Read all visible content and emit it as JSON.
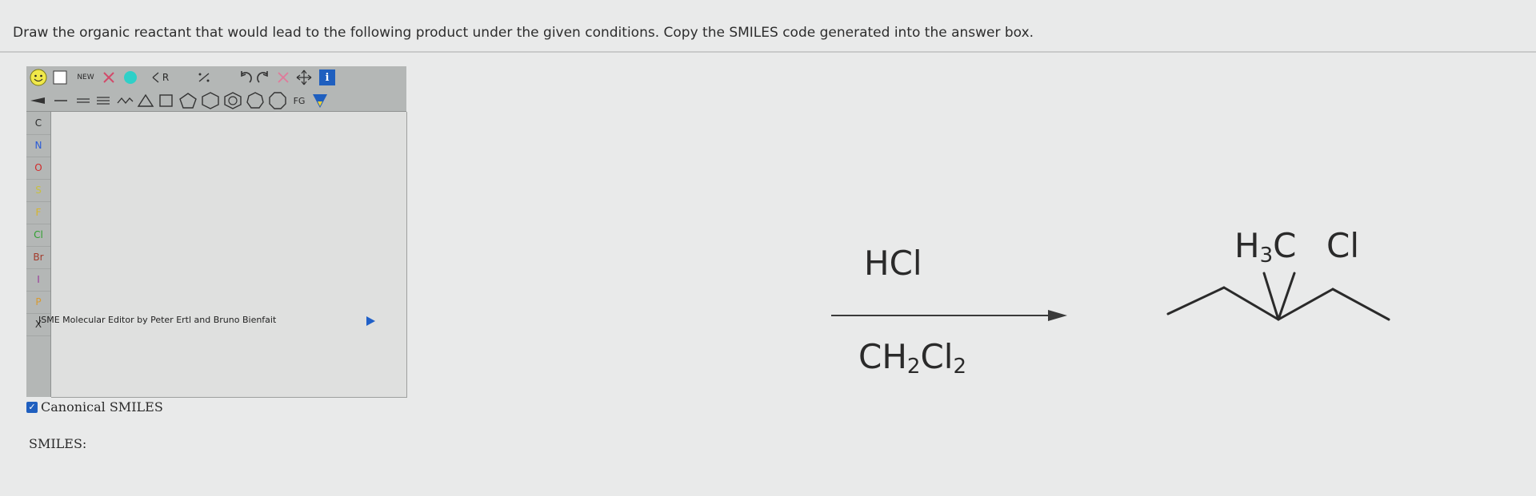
{
  "question": "Draw the organic reactant that would lead to the following product under the given conditions.  Copy the SMILES code generated into the answer box.",
  "jsme": {
    "toolbar_row1": {
      "new_label": "NEW",
      "r_label": "R",
      "fg_label": "FG"
    },
    "elements": [
      "C",
      "N",
      "O",
      "S",
      "F",
      "Cl",
      "Br",
      "I",
      "P",
      "X"
    ],
    "credit": "JSME Molecular Editor by Peter Ertl and Bruno Bienfait"
  },
  "canonical_smiles": {
    "checked": true,
    "label": "Canonical SMILES"
  },
  "smiles_label": "SMILES:",
  "reaction": {
    "reagent_top": "HCl",
    "reagent_bottom": {
      "main": "CH",
      "sub1": "2",
      "mid": "Cl",
      "sub2": "2"
    },
    "product": {
      "methyl_label": "H",
      "methyl_sub": "3",
      "methyl_c": "C",
      "chloro_label": "Cl"
    }
  },
  "colors": {
    "accent_blue": "#1f5fbf",
    "smiley_yellow": "#f0e84a",
    "element_N": "#2a5bd7",
    "element_O": "#d12a2a",
    "element_F": "#d7b62a",
    "element_Cl": "#2fa02f"
  }
}
